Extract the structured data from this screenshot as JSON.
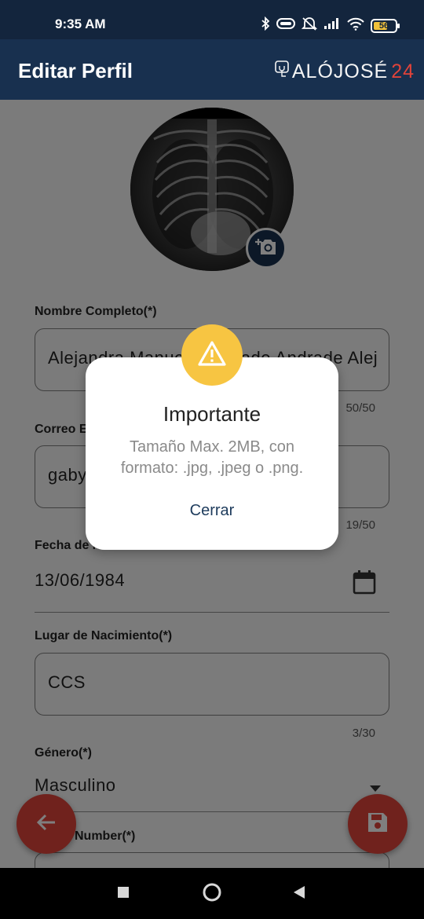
{
  "status_bar": {
    "time": "9:35 AM",
    "battery": "56",
    "icons": [
      "bluetooth-icon",
      "battery-saver-icon",
      "mute-icon",
      "signal-icon",
      "wifi-icon",
      "battery-icon"
    ]
  },
  "app_bar": {
    "title": "Editar Perfil",
    "brand_text": "ALÓJOSÉ",
    "brand_number": "24"
  },
  "form": {
    "full_name": {
      "label": "Nombre Completo(*)",
      "value": "Alejandra Manuela Andrade Andrade Alejandra",
      "counter": "50/50"
    },
    "email": {
      "label": "Correo E",
      "value": "gaby",
      "counter": "19/50"
    },
    "birth_date": {
      "label": "Fecha de N",
      "value": "13/06/1984"
    },
    "birth_place": {
      "label": "Lugar de Nacimiento(*)",
      "value": "CCS",
      "counter": "3/30"
    },
    "gender": {
      "label": "Género(*)",
      "value": "Masculino"
    },
    "phone": {
      "label": "Number(*)"
    }
  },
  "dialog": {
    "title": "Importante",
    "message": "Tamaño Max. 2MB, con formato: .jpg, .jpeg o .png.",
    "button": "Cerrar"
  },
  "colors": {
    "primary": "#18304f",
    "accent": "#e0453a",
    "warning": "#f7c542",
    "dialog_button": "#1d3b5c"
  }
}
